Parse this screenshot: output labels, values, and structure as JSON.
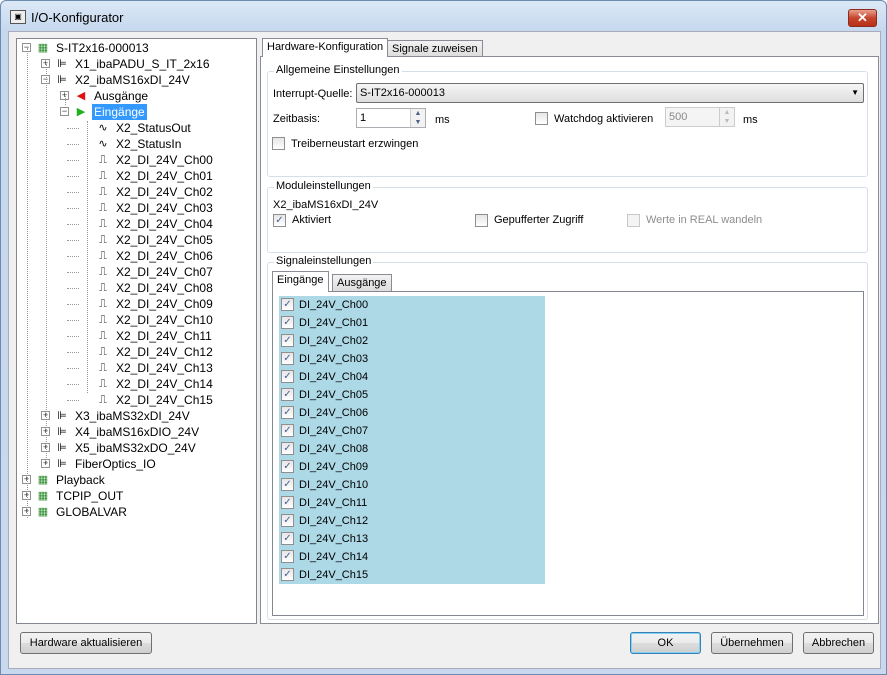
{
  "window": {
    "title": "I/O-Konfigurator",
    "close_label": "✕"
  },
  "tree": [
    {
      "label": "S-IT2x16-000013",
      "level": 0,
      "expander": "-",
      "icon": "board-icon"
    },
    {
      "label": "X1_ibaPADU_S_IT_2x16",
      "level": 1,
      "expander": "+",
      "icon": "module-icon"
    },
    {
      "label": "X2_ibaMS16xDI_24V",
      "level": 1,
      "expander": "-",
      "icon": "module-icon"
    },
    {
      "label": "Ausgänge",
      "level": 2,
      "expander": "+",
      "icon": "output-icon"
    },
    {
      "label": "Eingänge",
      "level": 2,
      "expander": "-",
      "icon": "input-icon",
      "selected": true
    },
    {
      "label": "X2_StatusOut",
      "level": 3,
      "icon": "analog-signal-icon"
    },
    {
      "label": "X2_StatusIn",
      "level": 3,
      "icon": "analog-signal-icon"
    },
    {
      "label": "X2_DI_24V_Ch00",
      "level": 3,
      "icon": "digital-signal-icon"
    },
    {
      "label": "X2_DI_24V_Ch01",
      "level": 3,
      "icon": "digital-signal-icon"
    },
    {
      "label": "X2_DI_24V_Ch02",
      "level": 3,
      "icon": "digital-signal-icon"
    },
    {
      "label": "X2_DI_24V_Ch03",
      "level": 3,
      "icon": "digital-signal-icon"
    },
    {
      "label": "X2_DI_24V_Ch04",
      "level": 3,
      "icon": "digital-signal-icon"
    },
    {
      "label": "X2_DI_24V_Ch05",
      "level": 3,
      "icon": "digital-signal-icon"
    },
    {
      "label": "X2_DI_24V_Ch06",
      "level": 3,
      "icon": "digital-signal-icon"
    },
    {
      "label": "X2_DI_24V_Ch07",
      "level": 3,
      "icon": "digital-signal-icon"
    },
    {
      "label": "X2_DI_24V_Ch08",
      "level": 3,
      "icon": "digital-signal-icon"
    },
    {
      "label": "X2_DI_24V_Ch09",
      "level": 3,
      "icon": "digital-signal-icon"
    },
    {
      "label": "X2_DI_24V_Ch10",
      "level": 3,
      "icon": "digital-signal-icon"
    },
    {
      "label": "X2_DI_24V_Ch11",
      "level": 3,
      "icon": "digital-signal-icon"
    },
    {
      "label": "X2_DI_24V_Ch12",
      "level": 3,
      "icon": "digital-signal-icon"
    },
    {
      "label": "X2_DI_24V_Ch13",
      "level": 3,
      "icon": "digital-signal-icon"
    },
    {
      "label": "X2_DI_24V_Ch14",
      "level": 3,
      "icon": "digital-signal-icon"
    },
    {
      "label": "X2_DI_24V_Ch15",
      "level": 3,
      "icon": "digital-signal-icon"
    },
    {
      "label": "X3_ibaMS32xDI_24V",
      "level": 1,
      "expander": "+",
      "icon": "module-icon"
    },
    {
      "label": "X4_ibaMS16xDIO_24V",
      "level": 1,
      "expander": "+",
      "icon": "module-icon"
    },
    {
      "label": "X5_ibaMS32xDO_24V",
      "level": 1,
      "expander": "+",
      "icon": "module-icon"
    },
    {
      "label": "FiberOptics_IO",
      "level": 1,
      "expander": "+",
      "icon": "module-icon"
    },
    {
      "label": "Playback",
      "level": 0,
      "expander": "+",
      "icon": "board-icon"
    },
    {
      "label": "TCPIP_OUT",
      "level": 0,
      "expander": "+",
      "icon": "board-icon"
    },
    {
      "label": "GLOBALVAR",
      "level": 0,
      "expander": "+",
      "icon": "board-icon"
    }
  ],
  "tabs": [
    {
      "label": "Hardware-Konfiguration",
      "active": true
    },
    {
      "label": "Signale zuweisen",
      "active": false
    }
  ],
  "general": {
    "title": "Allgemeine Einstellungen",
    "interrupt_label": "Interrupt-Quelle:",
    "interrupt_value": "S-IT2x16-000013",
    "timebase_label": "Zeitbasis:",
    "timebase_value": "1",
    "timebase_unit": "ms",
    "watchdog_label": "Watchdog aktivieren",
    "watchdog_checked": false,
    "watchdog_value": "500",
    "watchdog_unit": "ms",
    "restart_label": "Treiberneustart erzwingen",
    "restart_checked": false
  },
  "module": {
    "title": "Moduleinstellungen",
    "name": "X2_ibaMS16xDI_24V",
    "activated_label": "Aktiviert",
    "activated_checked": true,
    "buffered_label": "Gepufferter Zugriff",
    "buffered_checked": false,
    "real_label": "Werte in REAL wandeln",
    "real_checked": false
  },
  "signals": {
    "title": "Signaleinstellungen",
    "tabs": [
      {
        "label": "Eingänge",
        "active": true
      },
      {
        "label": "Ausgänge",
        "active": false
      }
    ],
    "items": [
      {
        "label": "DI_24V_Ch00",
        "checked": true
      },
      {
        "label": "DI_24V_Ch01",
        "checked": true
      },
      {
        "label": "DI_24V_Ch02",
        "checked": true
      },
      {
        "label": "DI_24V_Ch03",
        "checked": true
      },
      {
        "label": "DI_24V_Ch04",
        "checked": true
      },
      {
        "label": "DI_24V_Ch05",
        "checked": true
      },
      {
        "label": "DI_24V_Ch06",
        "checked": true
      },
      {
        "label": "DI_24V_Ch07",
        "checked": true
      },
      {
        "label": "DI_24V_Ch08",
        "checked": true
      },
      {
        "label": "DI_24V_Ch09",
        "checked": true
      },
      {
        "label": "DI_24V_Ch10",
        "checked": true
      },
      {
        "label": "DI_24V_Ch11",
        "checked": true
      },
      {
        "label": "DI_24V_Ch12",
        "checked": true
      },
      {
        "label": "DI_24V_Ch13",
        "checked": true
      },
      {
        "label": "DI_24V_Ch14",
        "checked": true
      },
      {
        "label": "DI_24V_Ch15",
        "checked": true
      }
    ],
    "highlight_color": "#add8e6"
  },
  "buttons": {
    "refresh": "Hardware aktualisieren",
    "ok": "OK",
    "apply": "Übernehmen",
    "cancel": "Abbrechen"
  },
  "glyphs": {
    "check": "✓",
    "dropdown": "▼",
    "up": "▲",
    "down": "▼"
  }
}
